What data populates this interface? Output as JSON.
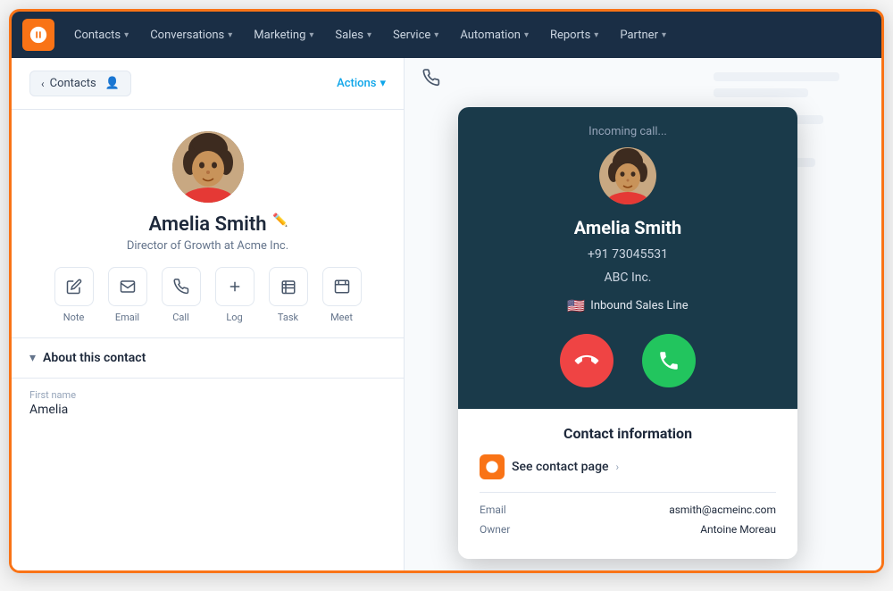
{
  "nav": {
    "items": [
      {
        "label": "Contacts",
        "id": "contacts"
      },
      {
        "label": "Conversations",
        "id": "conversations"
      },
      {
        "label": "Marketing",
        "id": "marketing"
      },
      {
        "label": "Sales",
        "id": "sales"
      },
      {
        "label": "Service",
        "id": "service"
      },
      {
        "label": "Automation",
        "id": "automation"
      },
      {
        "label": "Reports",
        "id": "reports"
      },
      {
        "label": "Partner",
        "id": "partner"
      }
    ]
  },
  "panel": {
    "back_label": "Contacts",
    "actions_label": "Actions"
  },
  "contact": {
    "name": "Amelia Smith",
    "title": "Director of Growth at Acme Inc.",
    "first_name": "Amelia",
    "action_buttons": [
      {
        "label": "Note",
        "icon": "✏️"
      },
      {
        "label": "Email",
        "icon": "✉"
      },
      {
        "label": "Call",
        "icon": "📞"
      },
      {
        "label": "Log",
        "icon": "+"
      },
      {
        "label": "Task",
        "icon": "☰"
      },
      {
        "label": "Meet",
        "icon": "📅"
      }
    ]
  },
  "about": {
    "title": "About this contact"
  },
  "first_name_field": {
    "label": "First name",
    "value": "Amelia"
  },
  "incoming_call": {
    "status": "Incoming call...",
    "caller_name": "Amelia Smith",
    "caller_phone": "+91 73045531",
    "caller_company": "ABC Inc.",
    "line_label": "Inbound Sales Line",
    "decline_icon": "📵",
    "accept_icon": "📞"
  },
  "contact_info": {
    "title": "Contact information",
    "see_contact_label": "See contact page",
    "email_label": "Email",
    "email_value": "asmith@acmeinc.com",
    "owner_label": "Owner",
    "owner_value": "Antoine Moreau"
  },
  "colors": {
    "nav_bg": "#1a2e45",
    "accent_orange": "#f97316",
    "accent_blue": "#0ea5e9",
    "call_bg": "#1a3a4a",
    "decline": "#ef4444",
    "accept": "#22c55e"
  }
}
